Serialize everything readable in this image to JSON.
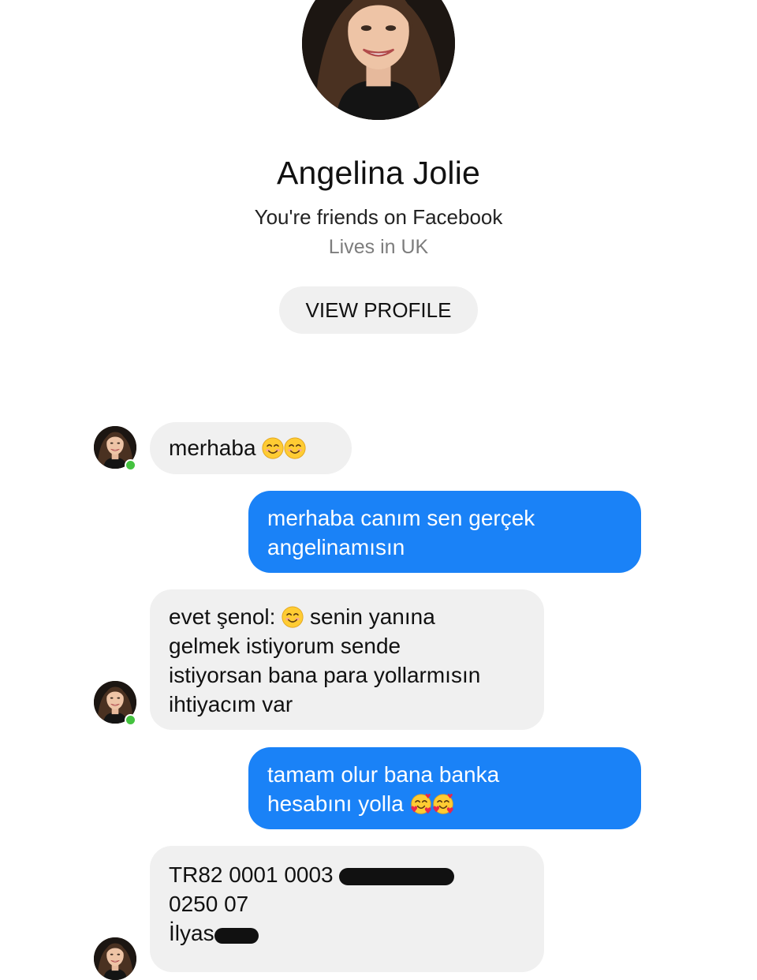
{
  "profile": {
    "name": "Angelina Jolie",
    "friends_text": "You're friends on Facebook",
    "location_text": "Lives in UK",
    "view_profile_label": "VIEW PROFILE"
  },
  "messages": [
    {
      "sender": "contact",
      "text": "merhaba",
      "emoji": [
        "smiling-face-emoji",
        "smiling-face-emoji"
      ]
    },
    {
      "sender": "me",
      "lines": [
        "merhaba canım sen gerçek",
        "angelinamısın"
      ]
    },
    {
      "sender": "contact",
      "line1_before": "evet şenol:",
      "line1_after": "senin yanına",
      "emoji": [
        "smiling-face-emoji"
      ],
      "lines_rest": [
        "gelmek istiyorum sende",
        "istiyorsan bana para yollarmısın",
        "ihtiyacım var"
      ]
    },
    {
      "sender": "me",
      "lines": [
        "tamam olur bana banka",
        "hesabını yolla"
      ],
      "emoji": [
        "smiling-face-with-hearts-emoji",
        "smiling-face-with-hearts-emoji"
      ]
    },
    {
      "sender": "contact",
      "lines": [
        "TR82 0001 0003",
        "0250 07",
        "İlyas"
      ],
      "redacted": true
    }
  ],
  "colors": {
    "incoming_bubble": "#f0f0f0",
    "outgoing_bubble": "#1a82f7",
    "online": "#44c23f",
    "secondary_text": "#7d7d7d"
  }
}
